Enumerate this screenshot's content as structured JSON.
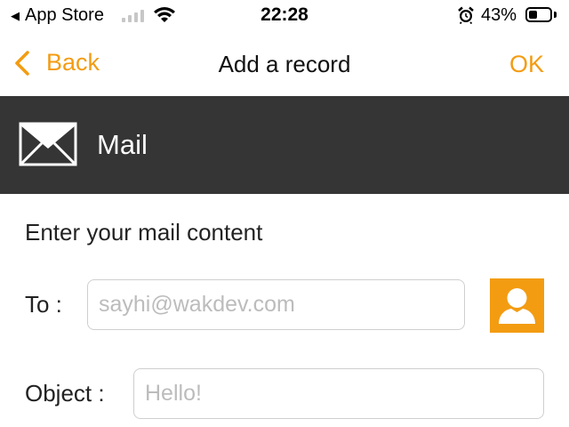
{
  "status_bar": {
    "back_app": "App Store",
    "time": "22:28",
    "battery_percent": "43%",
    "battery_level": 0.43,
    "signal_bars_active": 0,
    "signal_bars_total": 4
  },
  "nav": {
    "back_label": "Back",
    "title": "Add a record",
    "ok_label": "OK"
  },
  "section": {
    "title": "Mail"
  },
  "form": {
    "instructions": "Enter your mail content",
    "to_label": "To :",
    "to_placeholder": "sayhi@wakdev.com",
    "to_value": "",
    "object_label": "Object :",
    "object_placeholder": "Hello!",
    "object_value": ""
  },
  "colors": {
    "accent": "#f39c12",
    "header_bg": "#353535",
    "header_text": "#ffffff"
  },
  "icons": {
    "back": "chevron-left-icon",
    "section": "mail-envelope-icon",
    "contact": "person-icon",
    "alarm": "alarm-clock-icon",
    "wifi": "wifi-icon"
  }
}
